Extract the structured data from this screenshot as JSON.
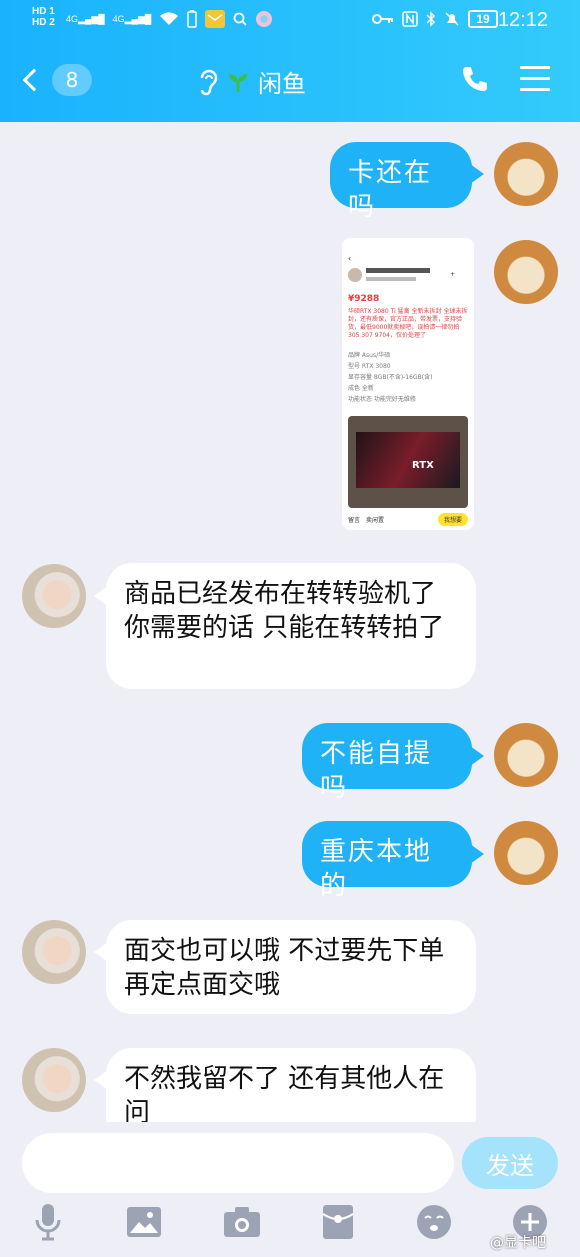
{
  "status_bar": {
    "hd1": "HD 1",
    "hd2": "HD 2",
    "net1": "4G",
    "net2": "4G",
    "battery": "19",
    "time": "12:12"
  },
  "header": {
    "back_count": "8",
    "title": "闲鱼"
  },
  "messages": [
    {
      "sender": "me",
      "text": "卡还在吗"
    },
    {
      "sender": "me",
      "type": "image"
    },
    {
      "sender": "them",
      "text": "商品已经发布在转转验机了你需要的话 只能在转转拍了"
    },
    {
      "sender": "me",
      "text": "不能自提吗"
    },
    {
      "sender": "me",
      "text": "重庆本地的"
    },
    {
      "sender": "them",
      "text": "面交也可以哦 不过要先下单再定点面交哦"
    },
    {
      "sender": "them",
      "text": "不然我留不了 还有其他人在问"
    }
  ],
  "shared_screenshot": {
    "price": "¥9288",
    "title_text": "华硕RTX 3080 Ti 猛禽 全新未拆封 全球未拆封，还有质保，官方正品，带发票，支持验货，最低9000就卖掉吧，误拍请一律勿拍 305 307 9704，仅价处理了",
    "specs": [
      "品牌 Asus/华硕",
      "型号 RTX 3080",
      "显存容量 8GB(不含)-16GB(含)",
      "成色 全新",
      "功能状态 功能完好无维修"
    ],
    "box_text": "RTX",
    "footer_want": "我想要",
    "footer_msg": "留言",
    "footer_bid": "卖闲置"
  },
  "composer": {
    "send_label": "发送"
  },
  "watermark": "@显卡吧"
}
